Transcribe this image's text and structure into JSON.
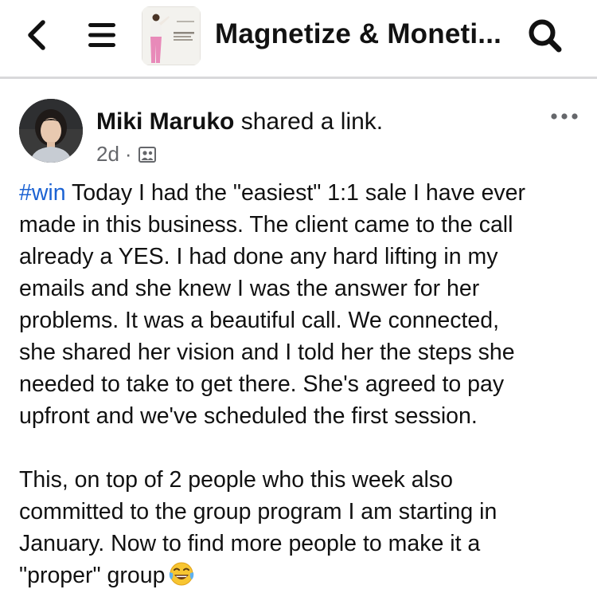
{
  "topbar": {
    "title": "Magnetize & Moneti...",
    "back_icon": "chevron-left-icon",
    "menu_icon": "hamburger-menu-icon",
    "search_icon": "search-icon"
  },
  "post": {
    "author": "Miki Maruko",
    "action": " shared a link.",
    "timestamp": "2d",
    "separator": "·",
    "audience_icon": "group-audience-icon",
    "more_icon": "more-options-icon",
    "hashtag": "#win",
    "lines": [
      " Today I had the \"easiest\" 1:1 sale I have ever",
      "made in this business.  The client came to the call",
      "already a YES.  I had done any hard lifting in my",
      "emails and she knew I was the answer for her",
      "problems.  It was a beautiful call.  We connected,",
      "she shared her vision and I told her the steps she",
      "needed to take to get there.  She's agreed to pay",
      "upfront and we've scheduled the first session."
    ],
    "lines2": [
      "This, on top of 2 people who this week also",
      "committed to the group program I am starting in",
      "January.  Now to find more people to make it a",
      "\"proper\" group"
    ],
    "emoji": "laughing-tears-emoji"
  },
  "colors": {
    "hashtag": "#1b62d3",
    "meta_text": "#65676b",
    "divider": "#d9d9db"
  }
}
